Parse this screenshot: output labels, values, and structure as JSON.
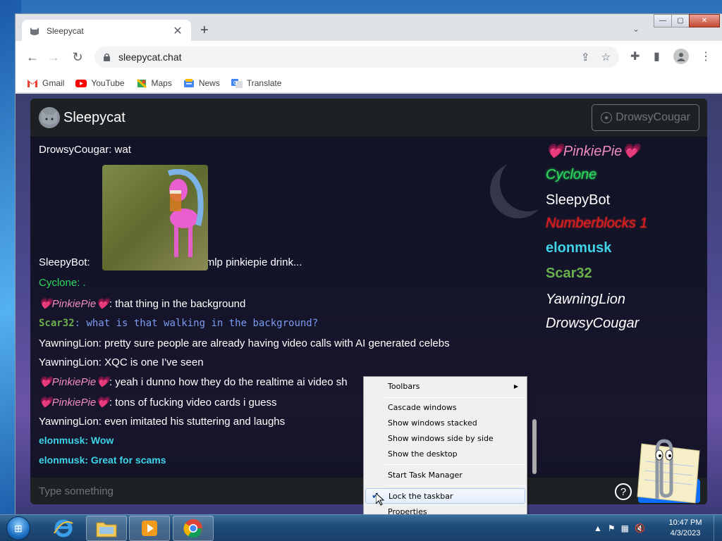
{
  "window": {
    "tab_title": "Sleepycat",
    "tab_close": "✕",
    "new_tab": "+",
    "tab_dropdown": "⌄",
    "min": "—",
    "max": "▢",
    "close": "✕"
  },
  "toolbar": {
    "back": "←",
    "forward": "→",
    "reload": "↻",
    "url": "sleepycat.chat",
    "lock": "🔒",
    "share": "⇪",
    "star": "☆",
    "extensions": "✚",
    "sidepanel": "▮",
    "menu": "⋮"
  },
  "bookmarks": [
    {
      "label": "Gmail",
      "icon": "gmail-icon",
      "color": "#ea4335"
    },
    {
      "label": "YouTube",
      "icon": "youtube-icon",
      "color": "#ff0000"
    },
    {
      "label": "Maps",
      "icon": "maps-icon",
      "color": "#34a853"
    },
    {
      "label": "News",
      "icon": "news-icon",
      "color": "#4285f4"
    },
    {
      "label": "Translate",
      "icon": "translate-icon",
      "color": "#4285f4"
    }
  ],
  "chat": {
    "brand": "Sleepycat",
    "current_user": "DrowsyCougar",
    "input_placeholder": "Type something",
    "help": "?",
    "send_icon": "➤",
    "messages": [
      {
        "name": "DrowsyCougar",
        "sep": ": ",
        "text": "wat",
        "style": "white"
      },
      {
        "name": "SleepyBot",
        "sep": ": ",
        "text": "mlp pinkiepie drink...",
        "style": "white"
      },
      {
        "name": "Cyclone",
        "sep": ": ",
        "text": ".",
        "style": "cyclone"
      },
      {
        "name": "💗PinkiePie💗",
        "sep": ": ",
        "text": "that thing in the background",
        "style": "pinkie"
      },
      {
        "name": "Scar32",
        "sep": ": ",
        "text": "what is that walking in the background?",
        "style": "scar"
      },
      {
        "name": "YawningLion",
        "sep": ": ",
        "text": "pretty sure people are already having video calls with AI generated celebs",
        "style": "white"
      },
      {
        "name": "YawningLion",
        "sep": ": ",
        "text": "XQC is one I've seen",
        "style": "white"
      },
      {
        "name": "💗PinkiePie💗",
        "sep": ": ",
        "text": "yeah i dunno how they do the realtime ai video sh",
        "style": "pinkie"
      },
      {
        "name": "💗PinkiePie💗",
        "sep": ": ",
        "text": "tons of fucking video cards i guess",
        "style": "pinkie"
      },
      {
        "name": "YawningLion",
        "sep": ": ",
        "text": "even imitated his stuttering and laughs",
        "style": "white"
      },
      {
        "name": "elonmusk",
        "sep": ": ",
        "text": "Wow",
        "style": "elon"
      },
      {
        "name": "elonmusk",
        "sep": ": ",
        "text": "Great for scams",
        "style": "elon"
      }
    ],
    "users": [
      {
        "name": "💗PinkiePie💗",
        "style": "pinkie"
      },
      {
        "name": "Cyclone",
        "style": "cyclone"
      },
      {
        "name": "SleepyBot",
        "style": "sleepybot"
      },
      {
        "name": "Numberblocks 1",
        "style": "numbers"
      },
      {
        "name": "elonmusk",
        "style": "elon"
      },
      {
        "name": "Scar32",
        "style": "scar"
      },
      {
        "name": "YawningLion",
        "style": "yawn"
      },
      {
        "name": "DrowsyCougar",
        "style": "drowsy"
      }
    ]
  },
  "context_menu": {
    "items": [
      {
        "label": "Toolbars",
        "submenu": "▶"
      },
      {
        "label": "Cascade windows"
      },
      {
        "label": "Show windows stacked"
      },
      {
        "label": "Show windows side by side"
      },
      {
        "label": "Show the desktop"
      },
      {
        "label": "Start Task Manager"
      },
      {
        "label": "Lock the taskbar",
        "checked": "✔"
      },
      {
        "label": "Properties"
      }
    ]
  },
  "taskbar": {
    "start_icon": "⊞",
    "tray_up": "▲",
    "flag": "⚑",
    "network": "▦",
    "volume": "🔇",
    "time": "10:47 PM",
    "date": "4/3/2023"
  }
}
